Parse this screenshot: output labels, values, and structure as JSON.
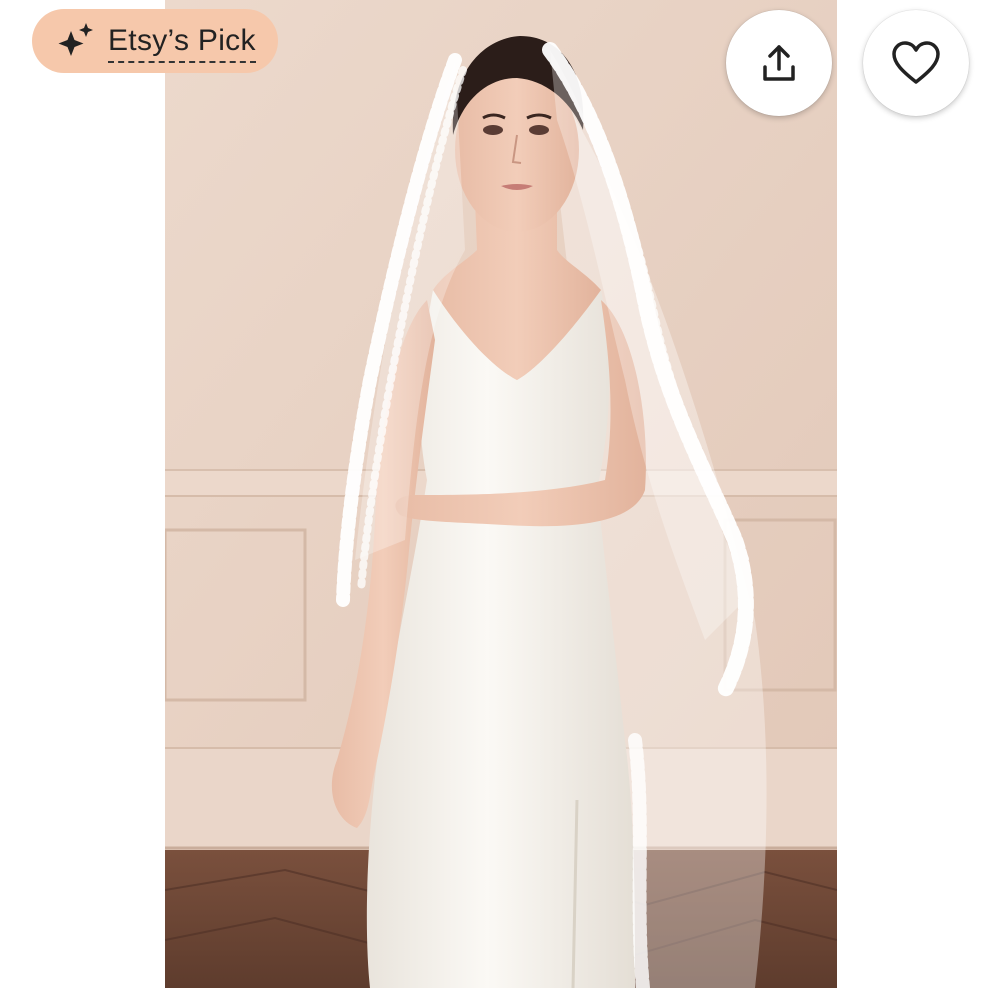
{
  "badge": {
    "label": "Etsy’s Pick",
    "icon": "sparkle-icon",
    "background": "#f6c8ab"
  },
  "actions": {
    "share_icon": "share-upload-icon",
    "favorite_icon": "heart-outline-icon"
  },
  "photo": {
    "subject": "product-photo-bride-in-lace-veil"
  },
  "colors": {
    "wall": "#e7d1c3",
    "floor": "#6b4636",
    "dress": "#f4f1ec"
  }
}
